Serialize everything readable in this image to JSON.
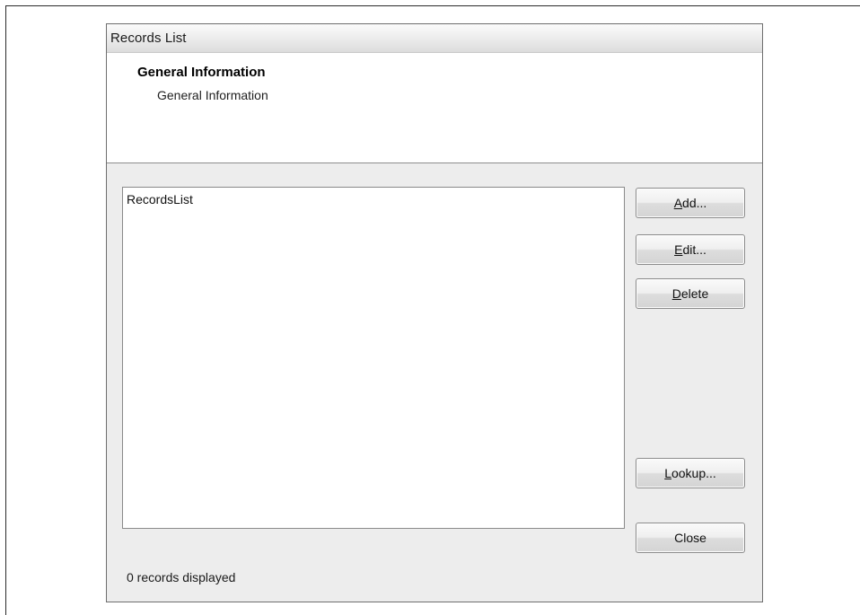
{
  "window": {
    "title": "Records List"
  },
  "header": {
    "title": "General Information",
    "subtitle": "General Information"
  },
  "list": {
    "items": [
      "RecordsList"
    ]
  },
  "buttons": {
    "add": {
      "mnemonic": "A",
      "rest": "dd..."
    },
    "edit": {
      "mnemonic": "E",
      "rest": "dit..."
    },
    "delete": {
      "mnemonic": "D",
      "rest": "elete"
    },
    "lookup": {
      "mnemonic": "L",
      "rest": "ookup..."
    },
    "close": {
      "label": "Close"
    }
  },
  "status": {
    "text": "0 records displayed"
  }
}
